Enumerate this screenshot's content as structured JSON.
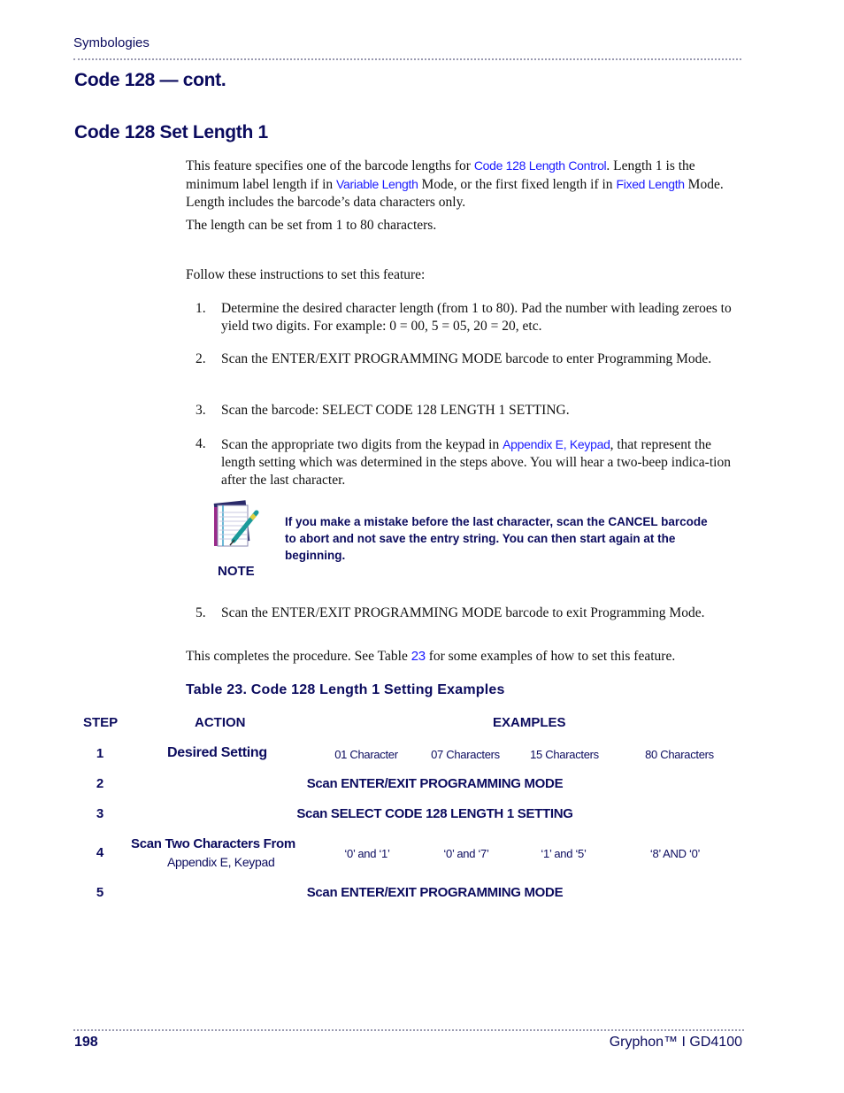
{
  "header": {
    "running_head": "Symbologies"
  },
  "headings": {
    "continued": "Code 128 — cont.",
    "section": "Code 128 Set Length 1"
  },
  "intro": {
    "p1_part1": "This feature specifies one of the barcode lengths for ",
    "p1_link1": "Code 128 Length Control",
    "p1_part2": ". Length 1 is the minimum label length if in ",
    "p1_link2": "Variable Length",
    "p1_part3": " Mode, or the first fixed length if in ",
    "p1_link3": "Fixed Length",
    "p1_part4": " Mode. Length includes the barcode’s data characters only.",
    "p2": "The length can be set from 1 to 80 characters.",
    "p3": "Follow these instructions to set this feature:"
  },
  "steps": [
    {
      "num": "1.",
      "text": "Determine the desired character length (from 1 to 80). Pad the number with leading zeroes to yield two digits. For example: 0 = 00, 5 = 05, 20 = 20, etc."
    },
    {
      "num": "2.",
      "text": "Scan the ENTER/EXIT PROGRAMMING MODE barcode to enter Programming Mode."
    },
    {
      "num": "3.",
      "text": "Scan the barcode: SELECT CODE 128 LENGTH 1 SETTING."
    },
    {
      "num": "4.",
      "text_before": "Scan the appropriate two digits from the keypad in ",
      "link": "Appendix E, Keypad",
      "text_after": ", that represent the length setting which was determined in the steps above. You will hear a two-beep indica-tion after the last character."
    },
    {
      "num": "5.",
      "text": "Scan the ENTER/EXIT PROGRAMMING MODE barcode to exit Programming Mode."
    }
  ],
  "note": {
    "icon": "notepad-pen-icon",
    "label": "NOTE",
    "text": "If you make a mistake before the last character, scan the CANCEL barcode to abort and not save the entry string. You can then start again at the beginning."
  },
  "closing": {
    "before": "This completes the procedure. See Table ",
    "link": "23",
    "after": " for some examples of how to set this feature."
  },
  "table": {
    "title": "Table 23. Code 128 Length 1 Setting Examples",
    "headers": {
      "step": "STEP",
      "action": "ACTION",
      "examples": "EXAMPLES"
    },
    "rows": [
      {
        "step": "1",
        "action": "Desired Setting",
        "examples": [
          "01 Character",
          "07 Characters",
          "15 Characters",
          "80 Characters"
        ]
      },
      {
        "step": "2",
        "span": "Scan ENTER/EXIT PROGRAMMING MODE"
      },
      {
        "step": "3",
        "span": "Scan SELECT CODE 128 LENGTH 1 SETTING"
      },
      {
        "step": "4",
        "action": "Scan Two Characters From",
        "action_link": "Appendix E, Keypad",
        "examples": [
          "‘0’ and ‘1’",
          "‘0’ and ‘7’",
          "‘1’ and ‘5’",
          "‘8’ AND ‘0’"
        ]
      },
      {
        "step": "5",
        "span": "Scan ENTER/EXIT PROGRAMMING MODE"
      }
    ]
  },
  "footer": {
    "page_number": "198",
    "product": "Gryphon™ I GD4100"
  }
}
